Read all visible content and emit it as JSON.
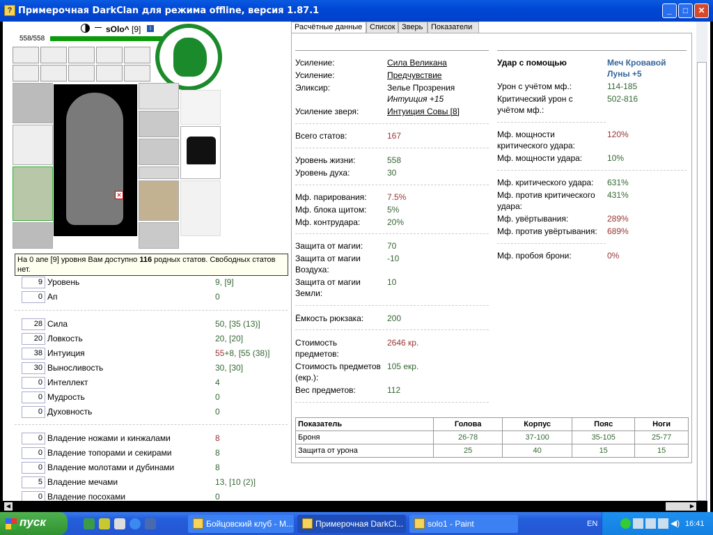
{
  "window": {
    "title": "Примерочная DarkClan для режима offline, версия 1.87.1",
    "min": "_",
    "max": "□",
    "close": "✕"
  },
  "char": {
    "nick": "sOlo^",
    "level": "[9]",
    "hp": "558/558",
    "notice_pre": "На 0 апе [9] уровня Вам доступно ",
    "notice_num": "116",
    "notice_post": " родных статов. Свободных статов нет."
  },
  "stats": [
    {
      "box": "9",
      "label": "Уровень",
      "val": "9, [9]",
      "color": "grn"
    },
    {
      "box": "0",
      "label": "Ап",
      "val": "0",
      "color": "grn"
    },
    {
      "box": "28",
      "label": "Сила",
      "val": "50, [35 (13)]",
      "color": "grn"
    },
    {
      "box": "20",
      "label": "Ловкость",
      "val": "20, [20]",
      "color": "grn"
    },
    {
      "box": "38",
      "label": "Интуиция",
      "val": "55",
      "val2": "+8, [55 (38)]",
      "color": "red"
    },
    {
      "box": "30",
      "label": "Выносливость",
      "val": "30, [30]",
      "color": "grn"
    },
    {
      "box": "0",
      "label": "Интеллект",
      "val": "4",
      "color": "grn"
    },
    {
      "box": "0",
      "label": "Мудрость",
      "val": "0",
      "color": "grn"
    },
    {
      "box": "0",
      "label": "Духовность",
      "val": "0",
      "color": "grn"
    },
    {
      "box": "0",
      "label": "Владение ножами и кинжалами",
      "val": "8",
      "color": "red"
    },
    {
      "box": "0",
      "label": "Владение топорами и секирами",
      "val": "8",
      "color": "grn"
    },
    {
      "box": "0",
      "label": "Владение молотами и дубинами",
      "val": "8",
      "color": "grn"
    },
    {
      "box": "5",
      "label": "Владение мечами",
      "val": "13, [10 (2)]",
      "color": "grn"
    },
    {
      "box": "0",
      "label": "Владение посохами",
      "val": "0",
      "color": "grn"
    }
  ],
  "tabs": [
    "Расчётные данные",
    "Список",
    "Зверь",
    "Показатели"
  ],
  "left": {
    "buffs": [
      {
        "label": "Усиление:",
        "val": "Сила Великана"
      },
      {
        "label": "Усиление:",
        "val": "Предчувствие"
      }
    ],
    "elixir_label": "Эликсир:",
    "elixir": "Зелье Прозрения",
    "elixir_sub": "Интуиция +15",
    "pet_label": "Усиление зверя:",
    "pet": "Интуиция Совы [8]",
    "total_label": "Всего статов:",
    "total": "167",
    "hp_label": "Уровень жизни:",
    "hp": "558",
    "sp_label": "Уровень духа:",
    "sp": "30",
    "parry_label": "Мф. парирования:",
    "parry": "7.5%",
    "block_label": "Мф. блока щитом:",
    "block": "5%",
    "counter_label": "Мф. контрудара:",
    "counter": "20%",
    "mag_label": "Защита от магии:",
    "mag": "70",
    "air_label": "Защита от магии",
    "air_label2": "Воздуха:",
    "air": "-10",
    "earth_label": "Защита от магии",
    "earth_label2": "Земли:",
    "earth": "10",
    "bag_label": "Ёмкость рюкзака:",
    "bag": "200",
    "cost_label": "Стоимость",
    "cost_label2": "предметов:",
    "cost": "2646 кр.",
    "ecost_label": "Стоимость предметов",
    "ecost_label2": "(екр.):",
    "ecost": "105 екр.",
    "weight_label": "Вес предметов:",
    "weight": "112"
  },
  "right": {
    "hit_label": "Удар с помощью",
    "weapon": "Меч Кровавой",
    "weapon2": "Луны +5",
    "dmg_label": "Урон с учётом мф.:",
    "dmg": "114-185",
    "crit_label": "Критический урон с",
    "crit_label2": "учётом мф.:",
    "crit": "502-816",
    "cpow_label": "Мф. мощности",
    "cpow_label2": "критического удара:",
    "cpow": "120%",
    "pow_label": "Мф. мощности удара:",
    "pow": "10%",
    "crt_label": "Мф. критического удара:",
    "crt": "631%",
    "acrt_label": "Мф. против критического",
    "acrt_label2": "удара:",
    "acrt": "431%",
    "dodge_label": "Мф. увёртывания:",
    "dodge": "289%",
    "adodge_label": "Мф. против увёртывания:",
    "adodge": "689%",
    "pierce_label": "Мф. пробоя брони:",
    "pierce": "0%"
  },
  "table": {
    "headers": [
      "Показатель",
      "Голова",
      "Корпус",
      "Пояс",
      "Ноги"
    ],
    "rows": [
      [
        "Броня",
        "26-78",
        "37-100",
        "35-105",
        "25-77"
      ],
      [
        "Защита от урона",
        "25",
        "40",
        "15",
        "15"
      ]
    ]
  },
  "taskbar": {
    "start": "пуск",
    "items": [
      "Бойцовский клуб - M...",
      "Примерочная DarkCl...",
      "solo1 - Paint"
    ],
    "lang": "EN",
    "time": "16:41"
  }
}
